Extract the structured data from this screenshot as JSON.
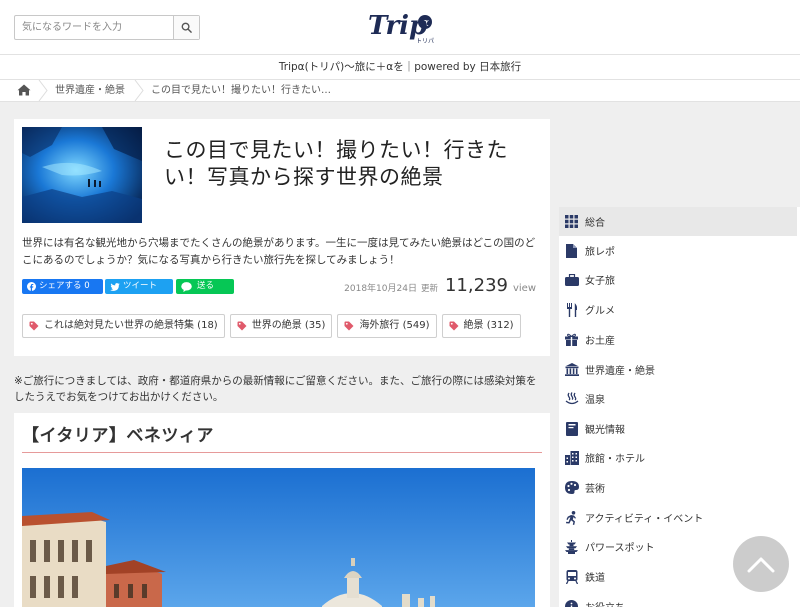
{
  "search": {
    "placeholder": "気になるワードを入力"
  },
  "logo": {
    "main": "Trip",
    "alpha": "α",
    "sub": "トリパ"
  },
  "tagline": "Tripα(トリパ)〜旅に＋αを｜powered by 日本旅行",
  "breadcrumb": {
    "items": [
      {
        "label": "世界遺産・絶景"
      },
      {
        "label": "この目で見たい！撮りたい！行きたい…"
      }
    ]
  },
  "article": {
    "title": "この目で見たい！撮りたい！行きたい！写真から探す世界の絶景",
    "description": "世界には有名な観光地から穴場までたくさんの絶景があります。一生に一度は見てみたい絶景はどこの国のどこにあるのでしょうか？気になる写真から行きたい旅行先を探してみましょう！",
    "share": {
      "facebook": "シェアする 0",
      "twitter": "ツイート",
      "line": "送る"
    },
    "date": "2018年10月24日",
    "update_label": "更新",
    "views": "11,239",
    "views_label": "view",
    "tags": [
      {
        "label": "これは絶対見たい世界の絶景特集 (18)"
      },
      {
        "label": "世界の絶景 (35)"
      },
      {
        "label": "海外旅行 (549)"
      },
      {
        "label": "絶景 (312)"
      }
    ]
  },
  "notice": "※ご旅行につきましては、政府・都道府県からの最新情報にご留意ください。また、ご旅行の際には感染対策をしたうえでお気をつけてお出かけください。",
  "section": {
    "title": "【イタリア】ベネツィア"
  },
  "sidebar": {
    "items": [
      {
        "label": "総合",
        "icon": "grid-icon"
      },
      {
        "label": "旅レポ",
        "icon": "document-icon"
      },
      {
        "label": "女子旅",
        "icon": "bag-icon"
      },
      {
        "label": "グルメ",
        "icon": "fork-knife-icon"
      },
      {
        "label": "お土産",
        "icon": "gift-icon"
      },
      {
        "label": "世界遺産・絶景",
        "icon": "temple-icon"
      },
      {
        "label": "温泉",
        "icon": "hot-spring-icon"
      },
      {
        "label": "観光情報",
        "icon": "book-icon"
      },
      {
        "label": "旅館・ホテル",
        "icon": "building-icon"
      },
      {
        "label": "芸術",
        "icon": "palette-icon"
      },
      {
        "label": "アクティビティ・イベント",
        "icon": "runner-icon"
      },
      {
        "label": "パワースポット",
        "icon": "pagoda-icon"
      },
      {
        "label": "鉄道",
        "icon": "train-icon"
      },
      {
        "label": "お役立ち",
        "icon": "info-icon"
      }
    ]
  },
  "colors": {
    "accent_underline": "#e69a9a",
    "icon_navy": "#2b3a67",
    "tag_icon": "#e05a6b",
    "facebook": "#1877f2",
    "twitter": "#1da1f2",
    "line": "#06c755"
  }
}
